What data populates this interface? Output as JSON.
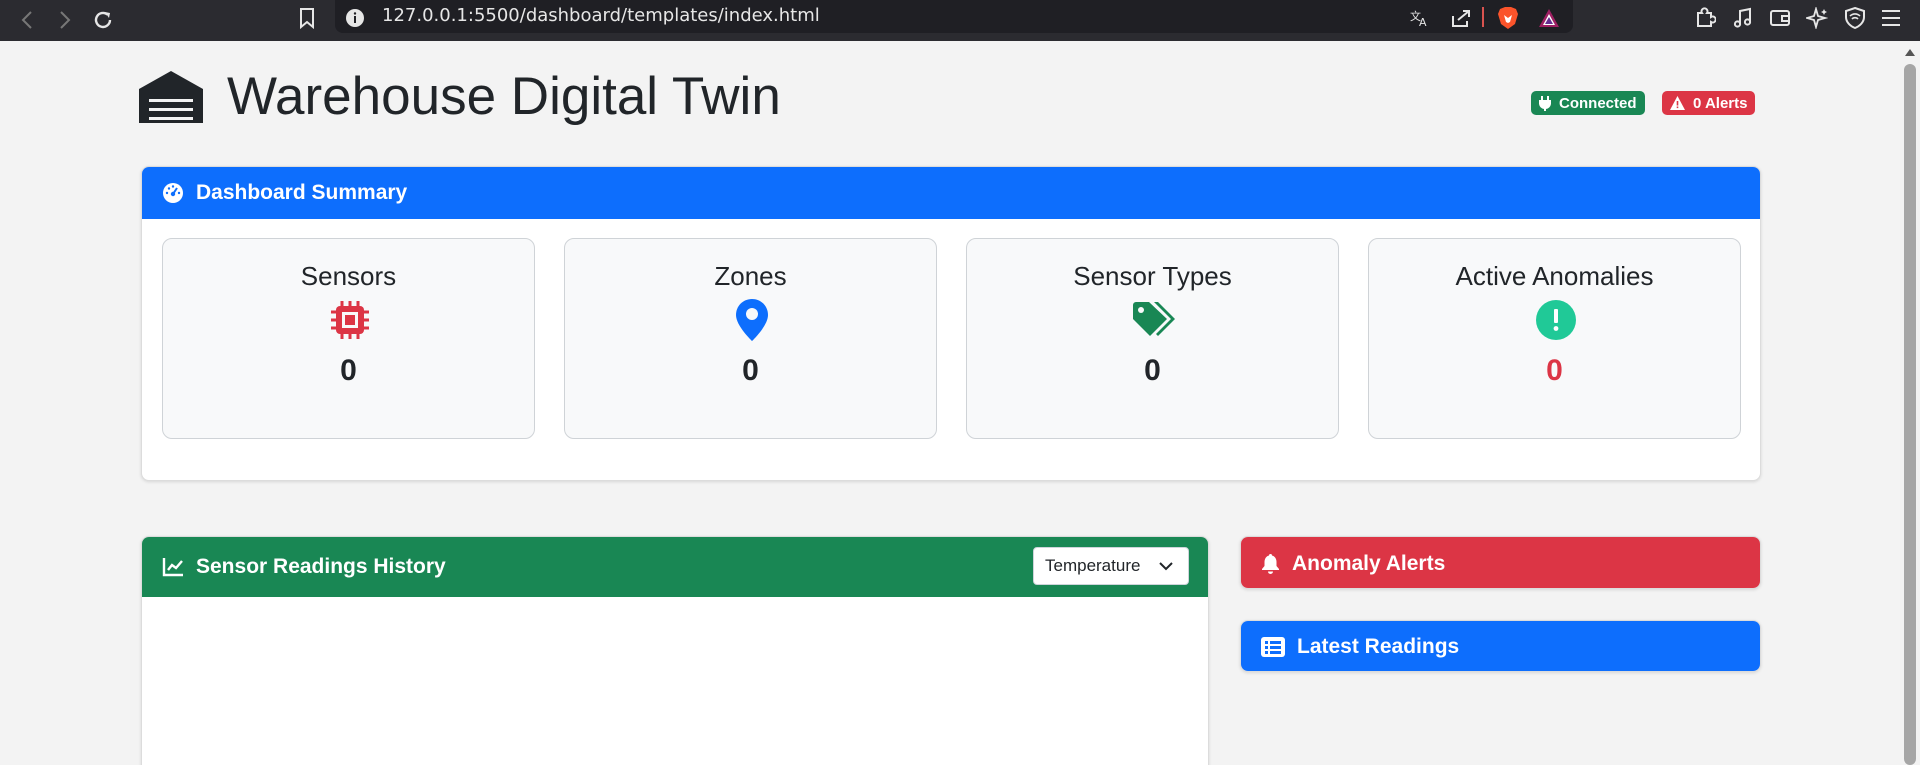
{
  "browser": {
    "url": "127.0.0.1:5500/dashboard/templates/index.html"
  },
  "header": {
    "title": "Warehouse Digital Twin",
    "status_badge": "Connected",
    "alerts_badge": "0 Alerts"
  },
  "summary": {
    "title": "Dashboard Summary",
    "stats": [
      {
        "label": "Sensors",
        "value": "0"
      },
      {
        "label": "Zones",
        "value": "0"
      },
      {
        "label": "Sensor Types",
        "value": "0"
      },
      {
        "label": "Active Anomalies",
        "value": "0"
      }
    ]
  },
  "history": {
    "title": "Sensor Readings History",
    "select_value": "Temperature"
  },
  "alerts_panel": {
    "title": "Anomaly Alerts"
  },
  "latest_panel": {
    "title": "Latest Readings"
  },
  "colors": {
    "primary": "#0d6efd",
    "success": "#198754",
    "danger": "#dc3545",
    "teal": "#20c997"
  }
}
